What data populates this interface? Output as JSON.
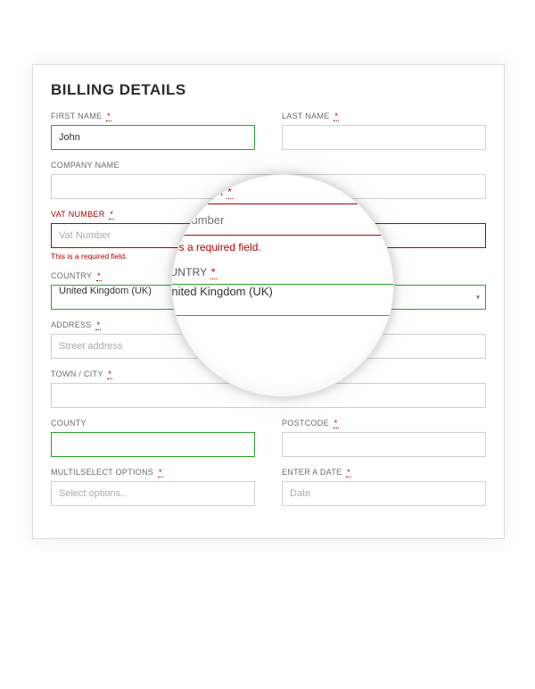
{
  "title": "BILLING DETAILS",
  "required_marker": "*",
  "fields": {
    "first_name": {
      "label": "FIRST NAME",
      "value": "John",
      "required": true
    },
    "last_name": {
      "label": "LAST NAME",
      "value": "",
      "required": true
    },
    "company_name": {
      "label": "COMPANY NAME",
      "value": "",
      "required": false
    },
    "vat_number": {
      "label": "VAT NUMBER",
      "placeholder": "Vat Number",
      "value": "",
      "required": true,
      "error": "This is a required field."
    },
    "country": {
      "label": "COUNTRY",
      "selected": "United Kingdom (UK)",
      "required": true
    },
    "address": {
      "label": "ADDRESS",
      "placeholder": "Street address",
      "value": "",
      "required": true
    },
    "town_city": {
      "label": "TOWN / CITY",
      "value": "",
      "required": true
    },
    "county": {
      "label": "COUNTY",
      "value": "",
      "required": false
    },
    "postcode": {
      "label": "POSTCODE",
      "value": "",
      "required": true
    },
    "multiselect": {
      "label": "MULTILSELECT OPTIONS",
      "placeholder": "Select options..",
      "required": true
    },
    "date": {
      "label": "ENTER A DATE",
      "placeholder": "Date",
      "required": true
    }
  },
  "magnifier": {
    "company_name": {
      "label": "PANY NAME",
      "value": ""
    },
    "vat_number": {
      "label": "VAT NUMBER",
      "placeholder": "Vat Number",
      "error": "This is a required field."
    },
    "country": {
      "label": "COUNTRY",
      "selected": "United Kingdom (UK)"
    }
  }
}
